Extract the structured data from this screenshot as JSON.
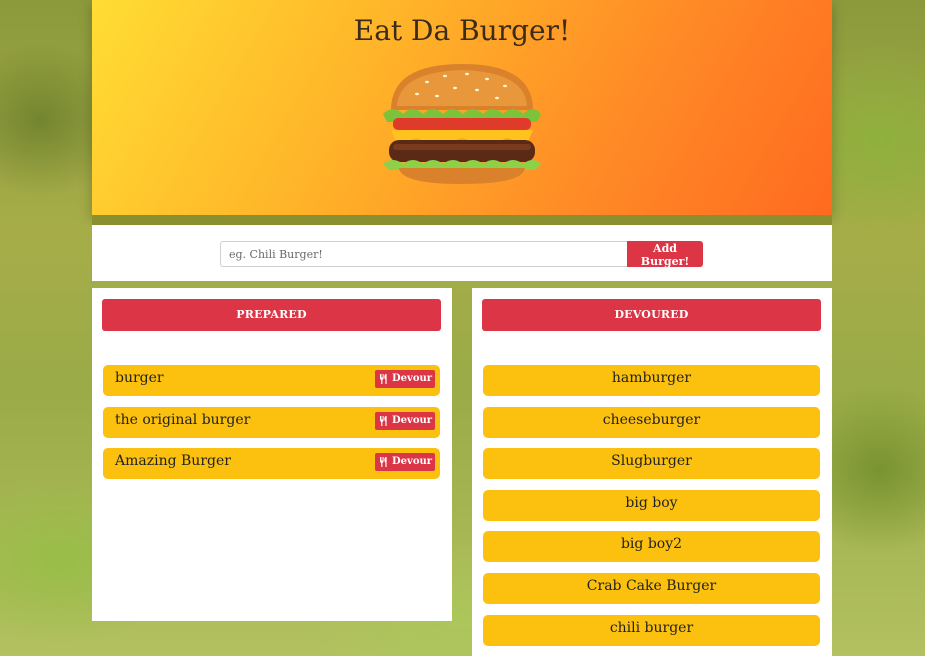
{
  "header": {
    "title": "Eat Da Burger!",
    "image_alt": "burger"
  },
  "form": {
    "placeholder": "eg. Chili Burger!",
    "value": "",
    "add_label": "Add Burger!"
  },
  "prepared": {
    "heading": "PREPARED",
    "items": [
      {
        "name": "burger",
        "action": "Devour"
      },
      {
        "name": "the original burger",
        "action": "Devour"
      },
      {
        "name": "Amazing Burger",
        "action": "Devour"
      }
    ]
  },
  "devoured": {
    "heading": "DEVOURED",
    "items": [
      {
        "name": "hamburger"
      },
      {
        "name": "cheeseburger"
      },
      {
        "name": "Slugburger"
      },
      {
        "name": "big boy"
      },
      {
        "name": "big boy2"
      },
      {
        "name": "Crab Cake Burger"
      },
      {
        "name": "chili burger"
      }
    ]
  },
  "colors": {
    "accent": "#dc3545",
    "item_bg": "#fcc10f",
    "hero_start": "#ffdd33",
    "hero_end": "#ff6a20"
  },
  "icons": {
    "devour": "utensils-icon"
  }
}
